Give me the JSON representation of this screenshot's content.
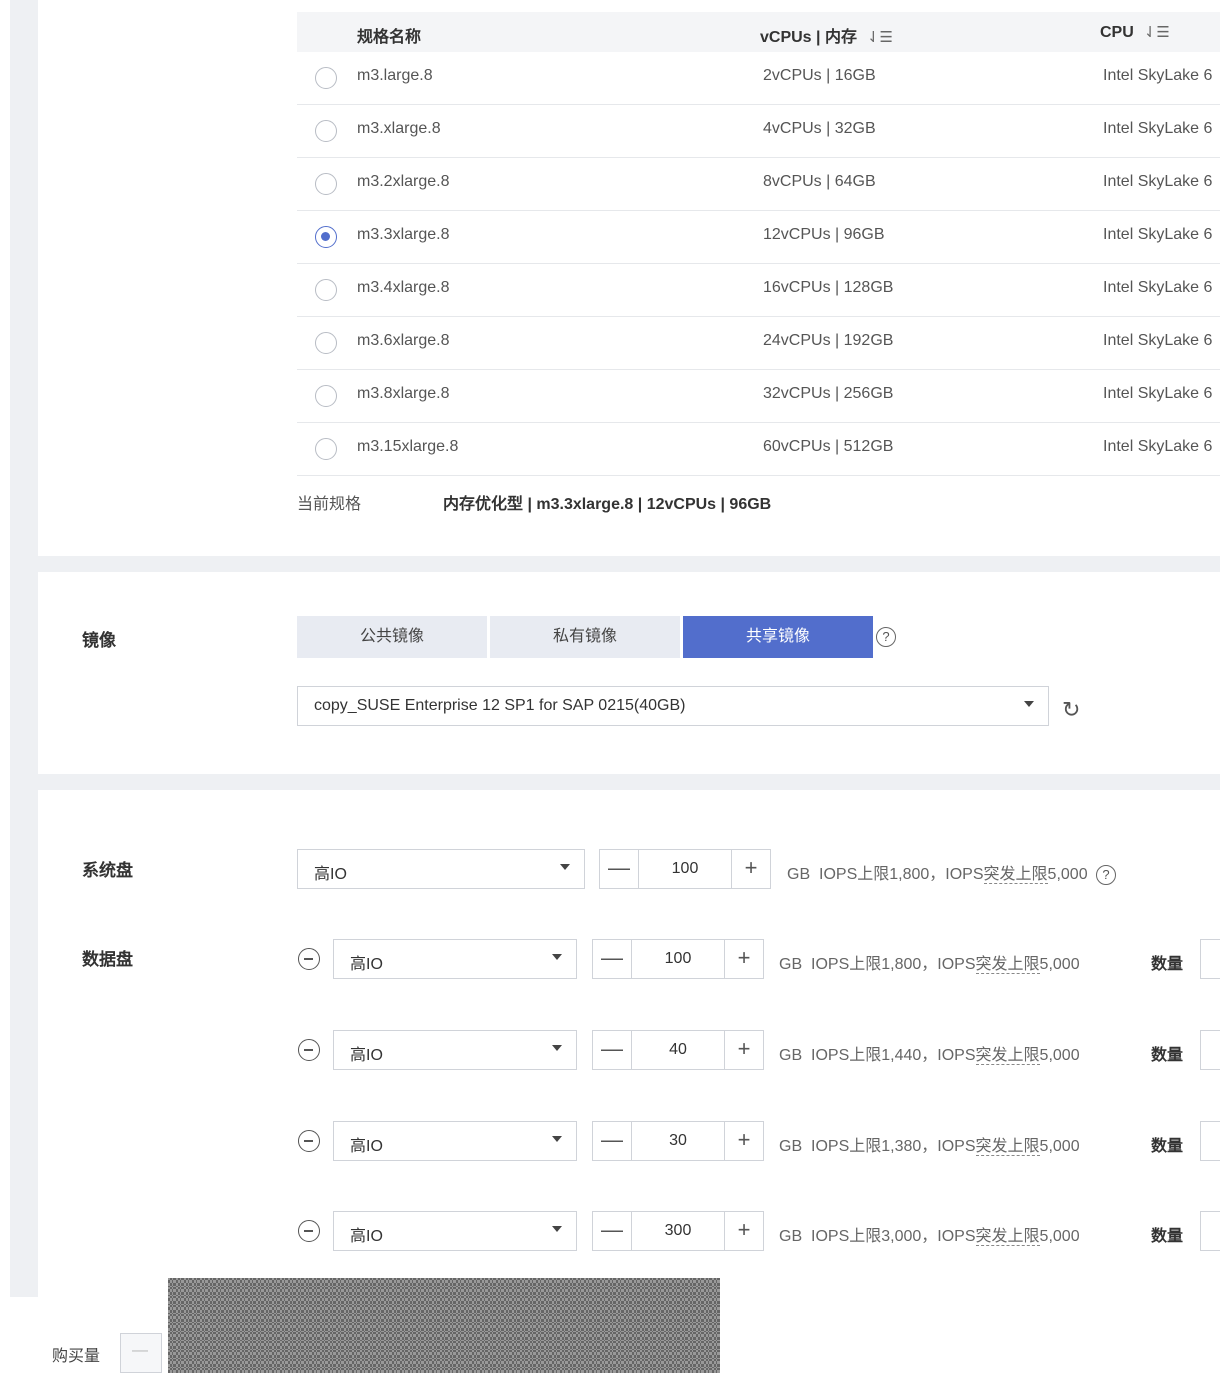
{
  "spec_table": {
    "headers": {
      "name": "规格名称",
      "vcpu_mem": "vCPUs | 内存",
      "cpu": "CPU"
    },
    "sort_icon": "⇃☰",
    "rows": [
      {
        "name": "m3.large.8",
        "vcpu_mem": "2vCPUs | 16GB",
        "cpu": "Intel SkyLake 6",
        "selected": false
      },
      {
        "name": "m3.xlarge.8",
        "vcpu_mem": "4vCPUs | 32GB",
        "cpu": "Intel SkyLake 6",
        "selected": false
      },
      {
        "name": "m3.2xlarge.8",
        "vcpu_mem": "8vCPUs | 64GB",
        "cpu": "Intel SkyLake 6",
        "selected": false
      },
      {
        "name": "m3.3xlarge.8",
        "vcpu_mem": "12vCPUs | 96GB",
        "cpu": "Intel SkyLake 6",
        "selected": true
      },
      {
        "name": "m3.4xlarge.8",
        "vcpu_mem": "16vCPUs | 128GB",
        "cpu": "Intel SkyLake 6",
        "selected": false
      },
      {
        "name": "m3.6xlarge.8",
        "vcpu_mem": "24vCPUs | 192GB",
        "cpu": "Intel SkyLake 6",
        "selected": false
      },
      {
        "name": "m3.8xlarge.8",
        "vcpu_mem": "32vCPUs | 256GB",
        "cpu": "Intel SkyLake 6",
        "selected": false
      },
      {
        "name": "m3.15xlarge.8",
        "vcpu_mem": "60vCPUs | 512GB",
        "cpu": "Intel SkyLake 6",
        "selected": false
      }
    ],
    "current_label": "当前规格",
    "current_value": "内存优化型 | m3.3xlarge.8 | 12vCPUs | 96GB"
  },
  "image": {
    "label": "镜像",
    "tabs": [
      "公共镜像",
      "私有镜像",
      "共享镜像"
    ],
    "active_tab": 2,
    "help": "?",
    "selected_image": "copy_SUSE Enterprise 12 SP1 for SAP 0215(40GB)",
    "refresh": "↻"
  },
  "system_disk": {
    "label": "系统盘",
    "type": "高IO",
    "size": "100",
    "unit": "GB",
    "iops_a": "IOPS上限1,800，IOPS",
    "iops_b": "突发上限",
    "iops_c": "5,000",
    "help": "?"
  },
  "data_disk": {
    "label": "数据盘",
    "qty_label": "数量",
    "rows": [
      {
        "type": "高IO",
        "size": "100",
        "unit": "GB",
        "iops_a": "IOPS上限1,800，IOPS",
        "iops_b": "突发上限",
        "iops_c": "5,000"
      },
      {
        "type": "高IO",
        "size": "40",
        "unit": "GB",
        "iops_a": "IOPS上限1,440，IOPS",
        "iops_b": "突发上限",
        "iops_c": "5,000"
      },
      {
        "type": "高IO",
        "size": "30",
        "unit": "GB",
        "iops_a": "IOPS上限1,380，IOPS",
        "iops_b": "突发上限",
        "iops_c": "5,000"
      },
      {
        "type": "高IO",
        "size": "300",
        "unit": "GB",
        "iops_a": "IOPS上限3,000，IOPS",
        "iops_b": "突发上限",
        "iops_c": "5,000"
      }
    ]
  },
  "stepper": {
    "minus": "—",
    "plus": "+"
  },
  "purchase": {
    "label": "购买量",
    "minus": "—"
  }
}
